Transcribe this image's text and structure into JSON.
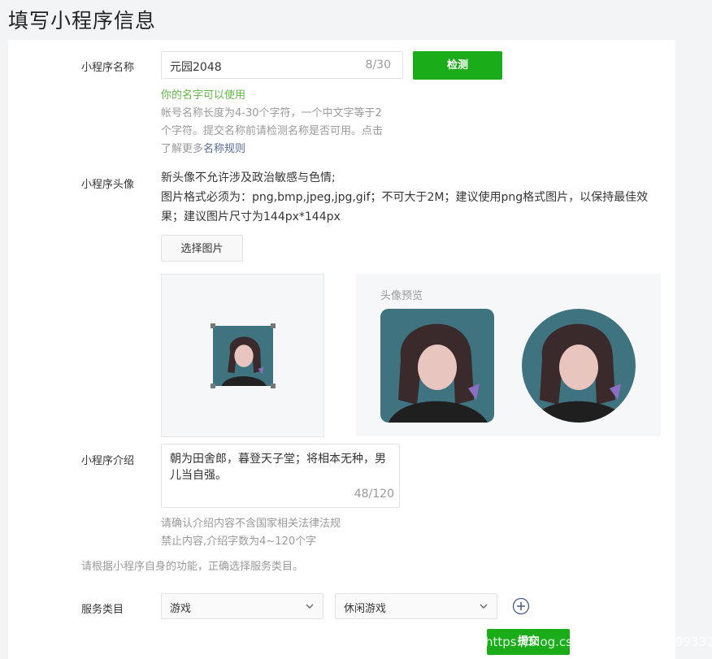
{
  "page_title": "填写小程序信息",
  "name_section": {
    "label": "小程序名称",
    "value": "元园2048",
    "counter": "8/30",
    "check_button": "检测",
    "ok_message": "你的名字可以使用",
    "tip_line1": "帐号名称长度为4-30个字符，一个中文字等于2",
    "tip_line2": "个字符。提交名称前请检测名称是否可用。点击",
    "tip_line3_prefix": "了解更多",
    "tip_link": "名称规则"
  },
  "avatar_section": {
    "label": "小程序头像",
    "rule_line1": "新头像不允许涉及政治敏感与色情;",
    "rule_line2": "图片格式必须为：png,bmp,jpeg,jpg,gif；不可大于2M；建议使用png格式图片，以保持最佳效",
    "rule_line3": "果；建议图片尺寸为144px*144px",
    "choose_button": "选择图片",
    "preview_title": "头像预览"
  },
  "intro_section": {
    "label": "小程序介绍",
    "value": "朝为田舍郎，暮登天子堂；将相本无种，男儿当自强。",
    "counter": "48/120",
    "tip_line1": "请确认介绍内容不含国家相关法律法规",
    "tip_line2": "禁止内容,介绍字数为4~120个字"
  },
  "category_section": {
    "hint": "请根据小程序自身的功能，正确选择服务类目。",
    "label": "服务类目",
    "primary_value": "游戏",
    "secondary_value": "休闲游戏"
  },
  "submit_button": "提交",
  "watermark": "https://blog.csdn.net/wangmx1993328",
  "colors": {
    "primary_green": "#1aad19",
    "ok_green": "#63b646",
    "link_blue": "#576b95",
    "muted_gray": "#9a9a9a"
  },
  "icons": {
    "select_arrow": "chevron-down-icon",
    "add_category": "plus-circle-icon"
  }
}
